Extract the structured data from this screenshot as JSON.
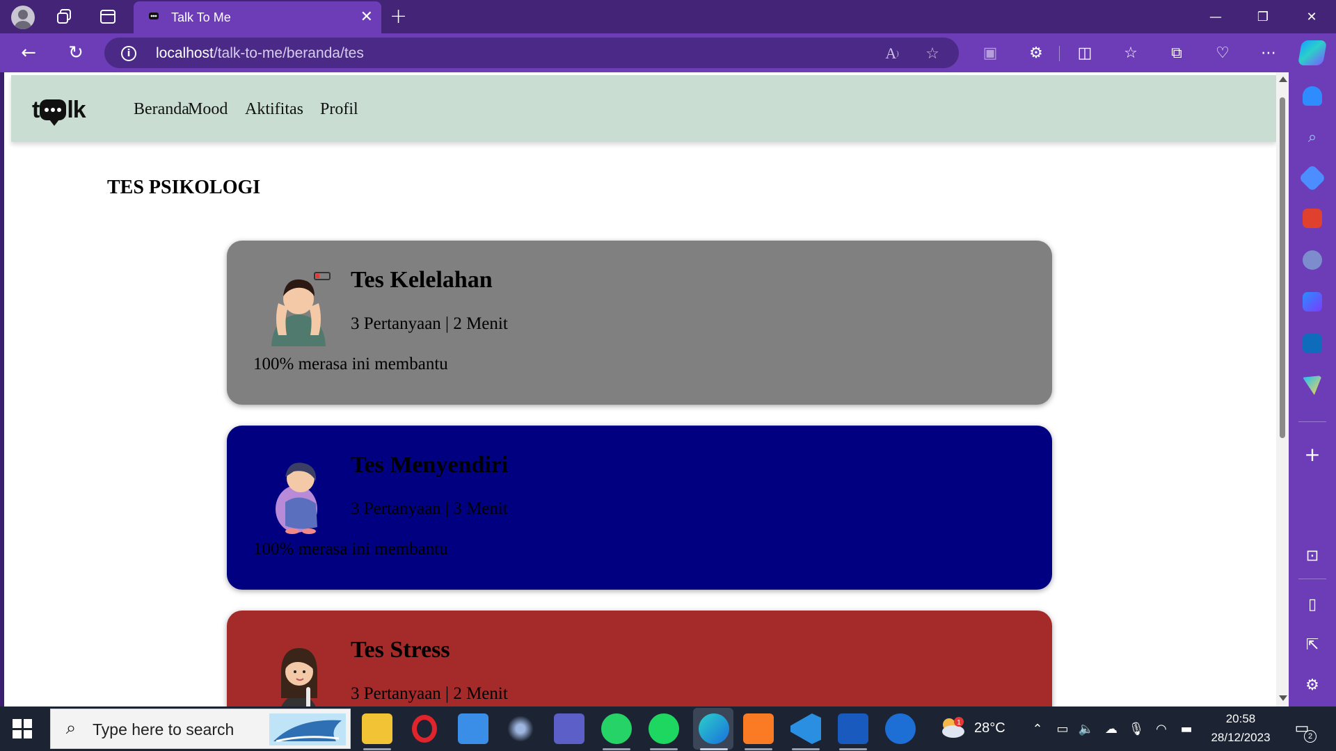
{
  "browser": {
    "tab_title": "Talk To Me",
    "url_host": "localhost",
    "url_path": "/talk-to-me/beranda/tes",
    "theme_colors": {
      "titlebar": "#432477",
      "toolbar": "#6c3db7"
    }
  },
  "site": {
    "logo_text_left": "t",
    "logo_text_right": "lk",
    "nav_links": [
      "Beranda",
      "Mood",
      "Aktifitas",
      "Profil"
    ],
    "nav_bg": "#c9ddd3"
  },
  "page": {
    "heading": "TES PSIKOLOGI",
    "tests": [
      {
        "title": "Tes Kelelahan",
        "meta": "3 Pertanyaan | 2 Menit",
        "help": "100% merasa ini membantu",
        "color": "#808080",
        "image": "exhausted-person-illustration"
      },
      {
        "title": "Tes Menyendiri",
        "meta": "3 Pertanyaan | 3 Menit",
        "help": "100% merasa ini membantu",
        "color": "#000080",
        "image": "lonely-person-illustration"
      },
      {
        "title": "Tes Stress",
        "meta": "3 Pertanyaan | 2 Menit",
        "help": "",
        "color": "#a52a2a",
        "image": "stressed-person-illustration"
      }
    ]
  },
  "taskbar": {
    "search_placeholder": "Type here to search",
    "weather_temp": "28°C",
    "weather_badge": "1",
    "time": "20:58",
    "date": "28/12/2023",
    "notification_count": "2",
    "apps": [
      "file-explorer",
      "opera",
      "mail",
      "app-orbit",
      "teams",
      "whatsapp",
      "spotify",
      "edge",
      "xampp",
      "vscode",
      "word",
      "help"
    ]
  }
}
